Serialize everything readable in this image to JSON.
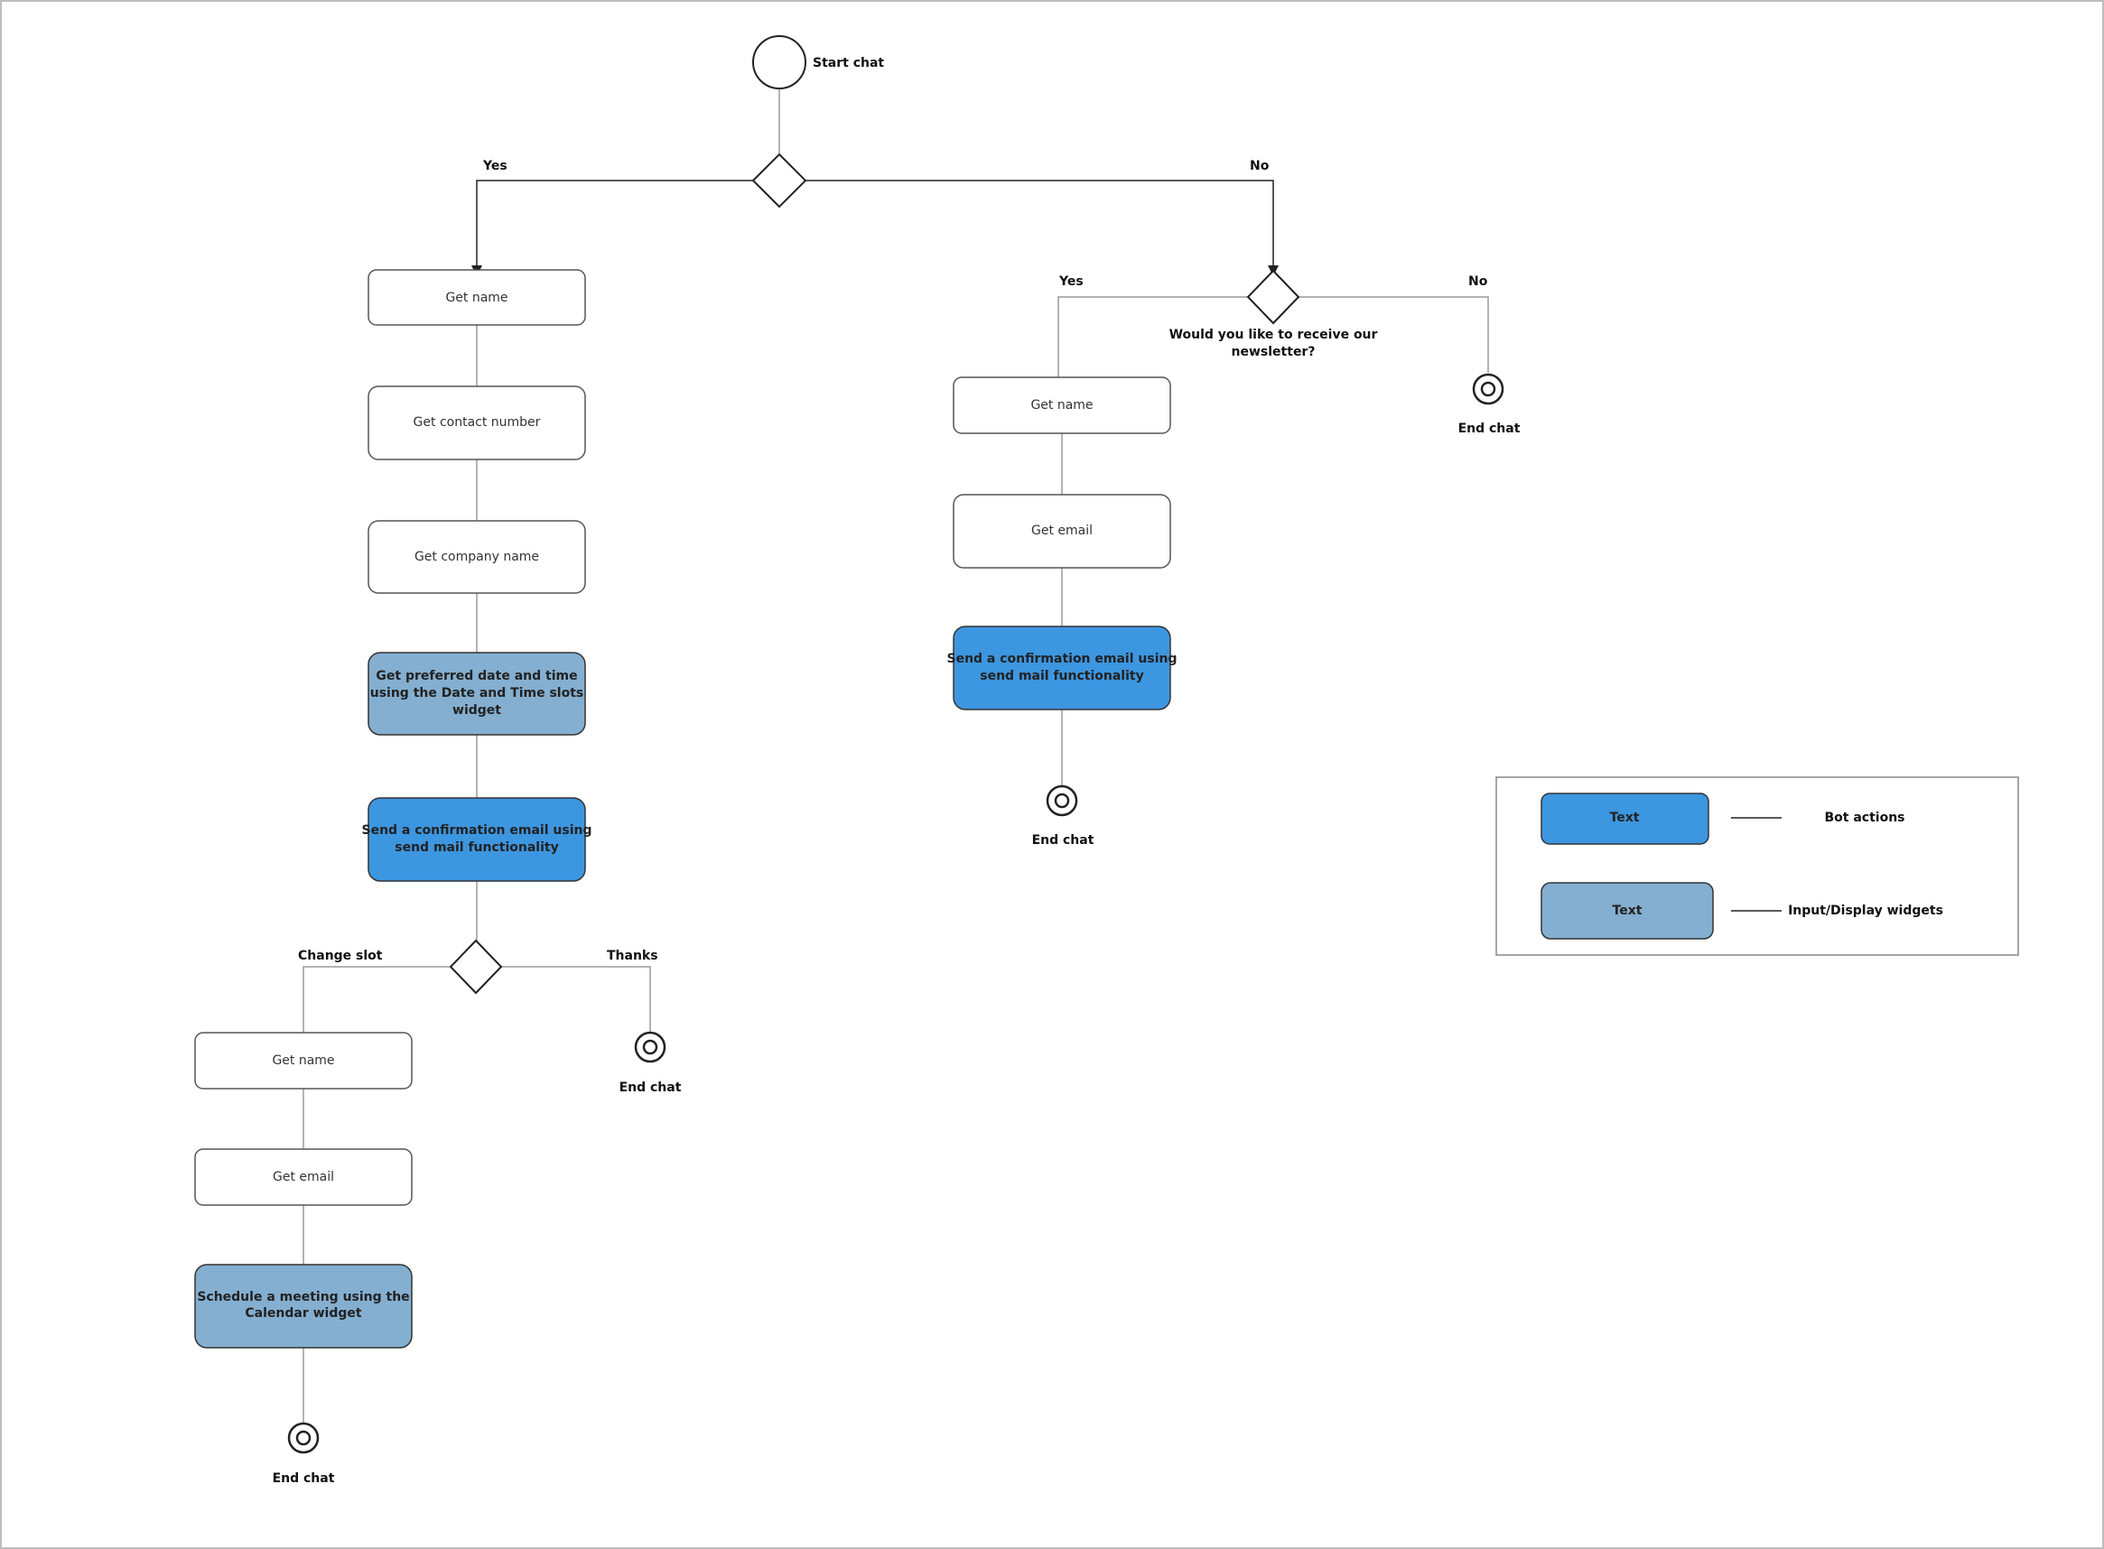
{
  "colors": {
    "bot_action": "#3d96e0",
    "widget": "#84afd0",
    "white": "#ffffff",
    "line_light": "#9a9a9a",
    "line_dark": "#222222"
  },
  "start": {
    "label": "Start chat"
  },
  "branches": {
    "main_yes": "Yes",
    "main_no": "No",
    "newsletter_yes": "Yes",
    "newsletter_no": "No",
    "change_slot": "Change slot",
    "thanks": "Thanks"
  },
  "newsletter_question": {
    "line1": "Would you like to receive our",
    "line2": "newsletter?"
  },
  "nodes": {
    "left_get_name": "Get name",
    "left_get_contact": "Get contact number",
    "left_get_company": "Get  company name",
    "left_date_time": [
      "Get preferred date and time",
      "using the Date and Time slots",
      "widget"
    ],
    "left_send_mail": [
      "Send a confirmation email using",
      "send mail functionality"
    ],
    "slot_get_name": "Get name",
    "slot_get_email": "Get  email",
    "slot_schedule": [
      "Schedule a meeting using the",
      "Calendar widget"
    ],
    "right_get_name": "Get name",
    "right_get_email": "Get  email",
    "right_send_mail": [
      "Send a confirmation email using",
      "send mail functionality"
    ]
  },
  "end_labels": {
    "newsletter_no": "End chat",
    "right_flow": "End chat",
    "thanks": "End chat",
    "slot_flow": "End chat"
  },
  "legend": {
    "bot_actions": {
      "swatch_text": "Text",
      "label": "Bot actions"
    },
    "widgets": {
      "swatch_text": "Text",
      "label": "Input/Display widgets"
    }
  }
}
